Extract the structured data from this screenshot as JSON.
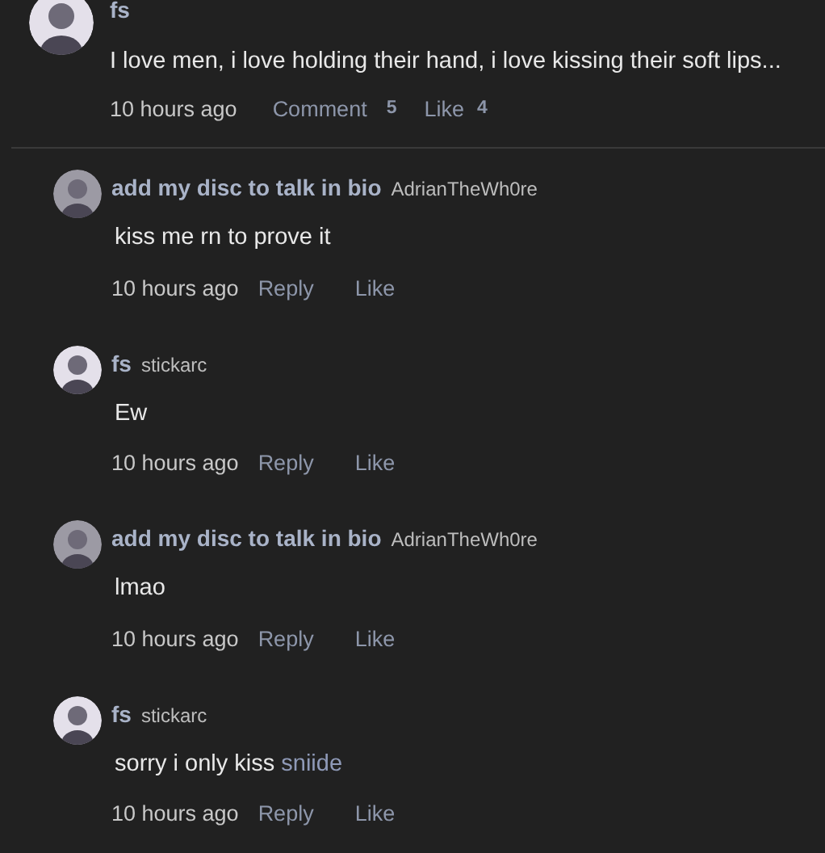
{
  "post": {
    "author": "fs",
    "color": "#e4e0ea",
    "text": "I love men, i love holding their hand, i love kissing their soft lips...",
    "time": "10 hours ago",
    "comment_label": "Comment",
    "comment_count": "5",
    "like_label": "Like",
    "like_count": "4"
  },
  "replies": [
    {
      "author": "add my disc to talk in bio",
      "handle": "AdrianTheWh0re",
      "color": "#9c9aa4",
      "text": "kiss me rn to prove it",
      "time": "10 hours ago",
      "reply_label": "Reply",
      "like_label": "Like"
    },
    {
      "author": "fs",
      "handle": "stickarc",
      "color": "#e4e0ea",
      "text": "Ew",
      "time": "10 hours ago",
      "reply_label": "Reply",
      "like_label": "Like"
    },
    {
      "author": "add my disc to talk in bio",
      "handle": "AdrianTheWh0re",
      "color": "#9c9aa4",
      "text": "lmao",
      "time": "10 hours ago",
      "reply_label": "Reply",
      "like_label": "Like"
    },
    {
      "author": "fs",
      "handle": "stickarc",
      "color": "#e4e0ea",
      "text": "sorry i only kiss",
      "mention": "sniide",
      "time": "10 hours ago",
      "reply_label": "Reply",
      "like_label": "Like"
    }
  ]
}
